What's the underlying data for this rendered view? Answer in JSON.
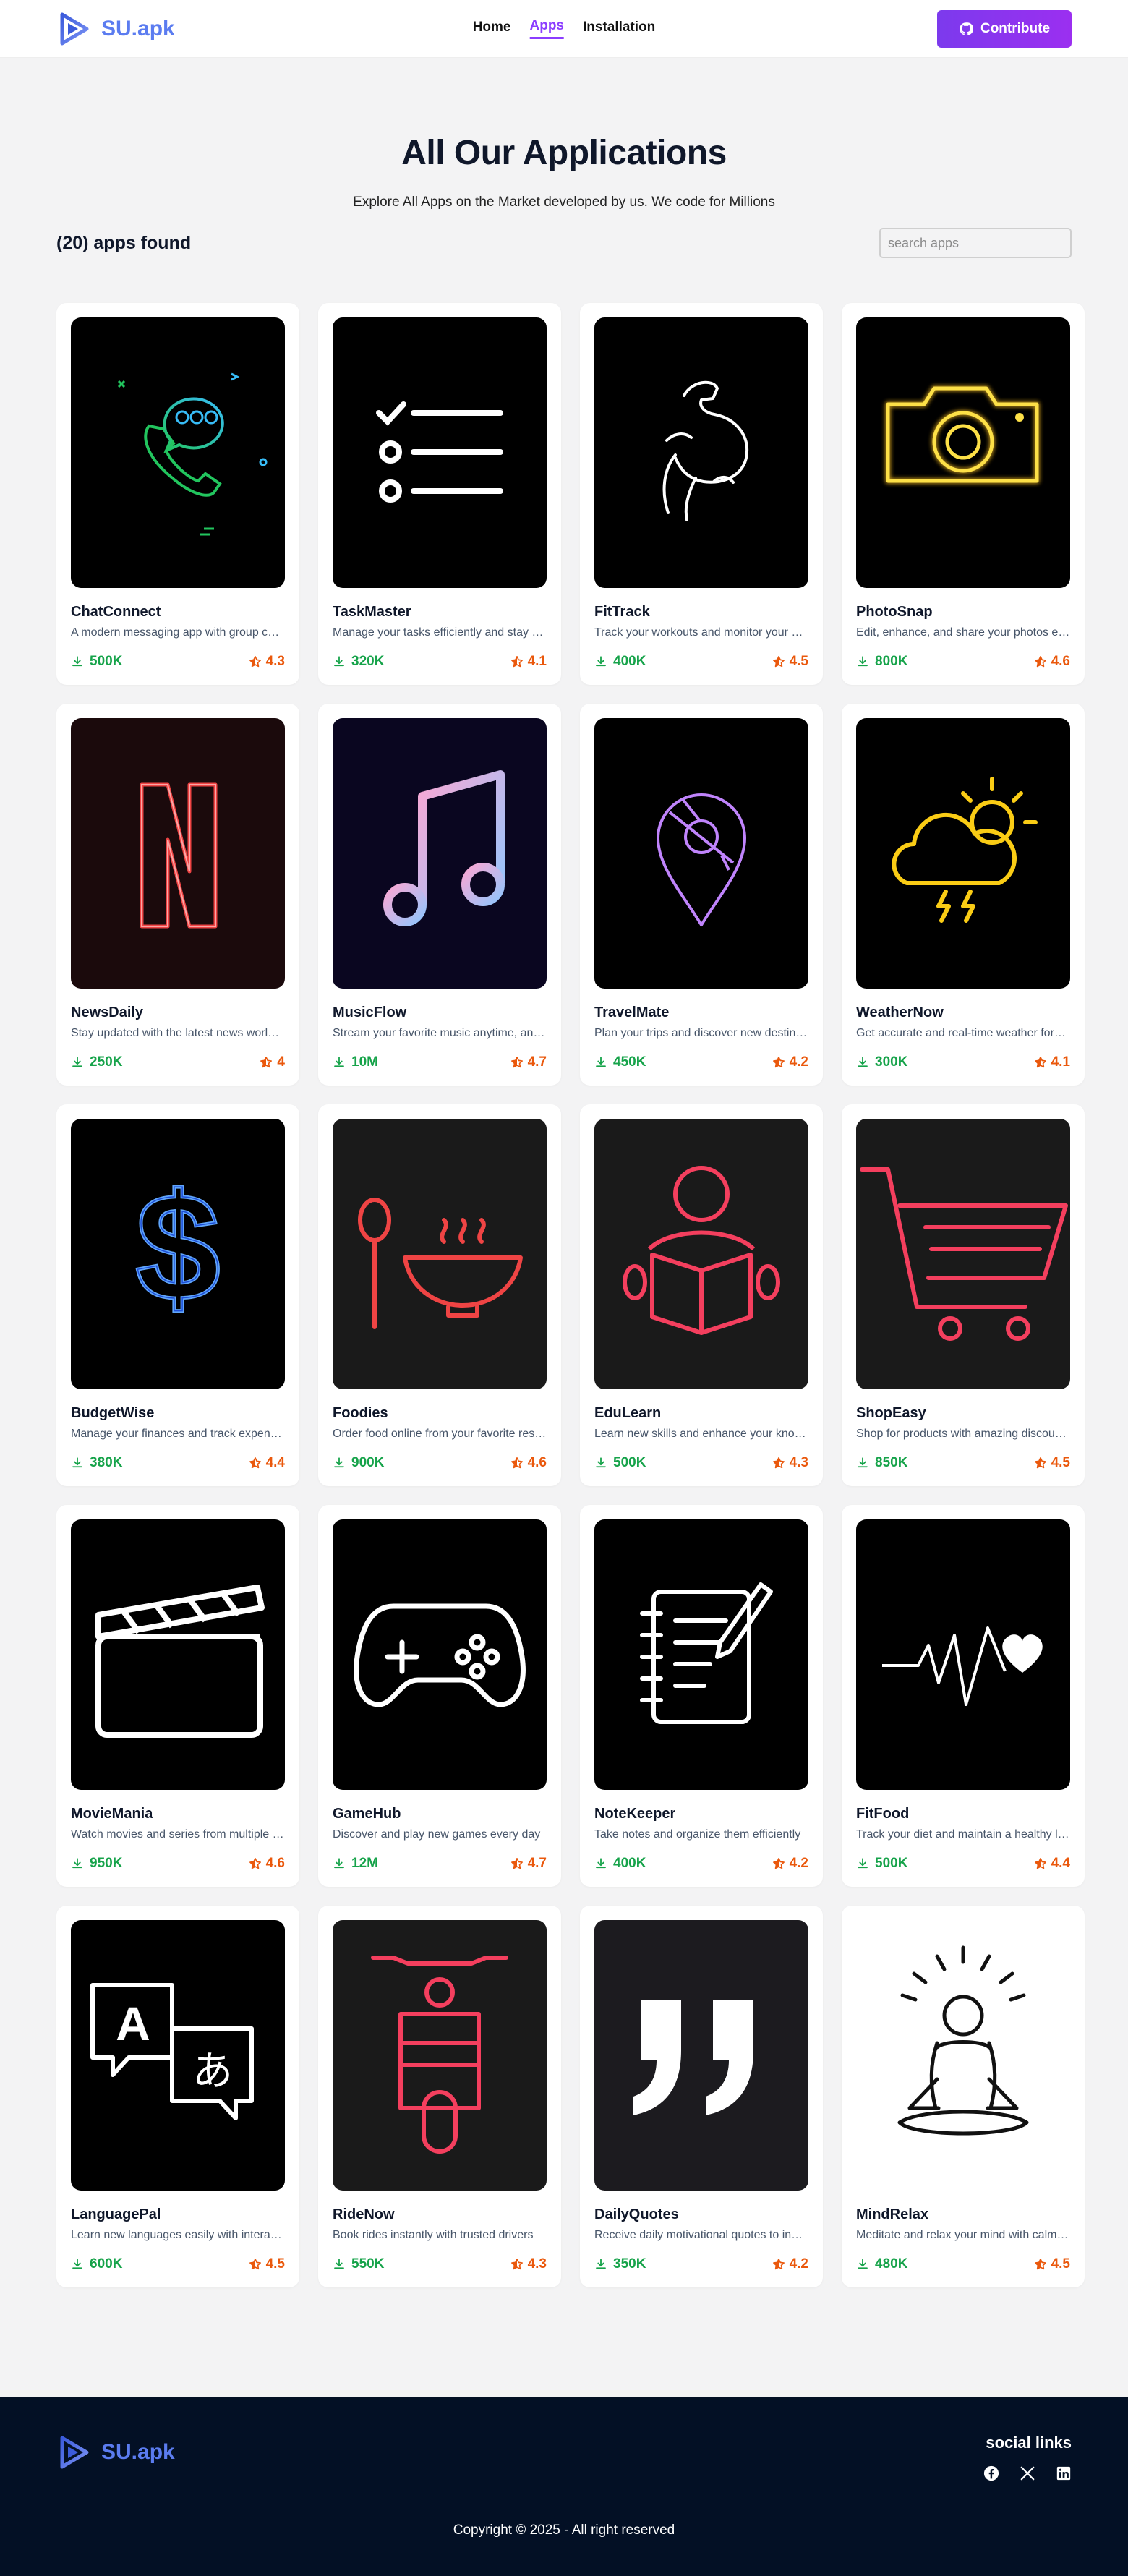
{
  "nav": {
    "brand": "SU.apk",
    "links": [
      "Home",
      "Apps",
      "Installation"
    ],
    "active": "Apps",
    "contribute": "Contribute"
  },
  "hero": {
    "title": "All Our Applications",
    "subtitle": "Explore All Apps on the Market developed by us. We code for Millions"
  },
  "toolbar": {
    "count": "(20) apps found",
    "search_placeholder": "search apps"
  },
  "apps": [
    {
      "name": "ChatConnect",
      "desc": "A modern messaging app with group chats",
      "downloads": "500K",
      "rating": "4.3",
      "icon": "chat-phone-icon"
    },
    {
      "name": "TaskMaster",
      "desc": "Manage your tasks efficiently and stay organized",
      "downloads": "320K",
      "rating": "4.1",
      "icon": "checklist-icon"
    },
    {
      "name": "FitTrack",
      "desc": "Track your workouts and monitor your progress",
      "downloads": "400K",
      "rating": "4.5",
      "icon": "muscle-arm-icon"
    },
    {
      "name": "PhotoSnap",
      "desc": "Edit, enhance, and share your photos easily",
      "downloads": "800K",
      "rating": "4.6",
      "icon": "camera-icon"
    },
    {
      "name": "NewsDaily",
      "desc": "Stay updated with the latest news worldwide",
      "downloads": "250K",
      "rating": "4",
      "icon": "letter-n-icon"
    },
    {
      "name": "MusicFlow",
      "desc": "Stream your favorite music anytime, anywhere",
      "downloads": "10M",
      "rating": "4.7",
      "icon": "music-note-icon"
    },
    {
      "name": "TravelMate",
      "desc": "Plan your trips and discover new destinations",
      "downloads": "450K",
      "rating": "4.2",
      "icon": "map-pin-icon"
    },
    {
      "name": "WeatherNow",
      "desc": "Get accurate and real-time weather forecasts",
      "downloads": "300K",
      "rating": "4.1",
      "icon": "weather-cloud-icon"
    },
    {
      "name": "BudgetWise",
      "desc": "Manage your finances and track expenses",
      "downloads": "380K",
      "rating": "4.4",
      "icon": "dollar-icon"
    },
    {
      "name": "Foodies",
      "desc": "Order food online from your favorite restaurants",
      "downloads": "900K",
      "rating": "4.6",
      "icon": "soup-bowl-icon"
    },
    {
      "name": "EduLearn",
      "desc": "Learn new skills and enhance your knowledge",
      "downloads": "500K",
      "rating": "4.3",
      "icon": "reader-book-icon"
    },
    {
      "name": "ShopEasy",
      "desc": "Shop for products with amazing discounts",
      "downloads": "850K",
      "rating": "4.5",
      "icon": "shopping-cart-icon"
    },
    {
      "name": "MovieMania",
      "desc": "Watch movies and series from multiple genres",
      "downloads": "950K",
      "rating": "4.6",
      "icon": "clapperboard-icon"
    },
    {
      "name": "GameHub",
      "desc": "Discover and play new games every day",
      "downloads": "12M",
      "rating": "4.7",
      "icon": "gamepad-icon"
    },
    {
      "name": "NoteKeeper",
      "desc": "Take notes and organize them efficiently",
      "downloads": "400K",
      "rating": "4.2",
      "icon": "notepad-icon"
    },
    {
      "name": "FitFood",
      "desc": "Track your diet and maintain a healthy lifestyle",
      "downloads": "500K",
      "rating": "4.4",
      "icon": "heartbeat-icon"
    },
    {
      "name": "LanguagePal",
      "desc": "Learn new languages easily with interactive lessons",
      "downloads": "600K",
      "rating": "4.5",
      "icon": "translate-icon"
    },
    {
      "name": "RideNow",
      "desc": "Book rides instantly with trusted drivers",
      "downloads": "550K",
      "rating": "4.3",
      "icon": "scooter-icon"
    },
    {
      "name": "DailyQuotes",
      "desc": "Receive daily motivational quotes to inspire you",
      "downloads": "350K",
      "rating": "4.2",
      "icon": "quote-icon"
    },
    {
      "name": "MindRelax",
      "desc": "Meditate and relax your mind with calming sounds",
      "downloads": "480K",
      "rating": "4.5",
      "icon": "meditation-icon"
    }
  ],
  "footer": {
    "brand": "SU.apk",
    "social_title": "social links",
    "social_icons": [
      "facebook-icon",
      "x-icon",
      "linkedin-icon"
    ],
    "copyright": "Copyright © 2025 - All right reserved"
  },
  "colors": {
    "accent": "#8b3dff",
    "brand": "#5b7cf0",
    "downloads": "#16a34a",
    "rating": "#ea580c",
    "footer_bg": "#031025"
  }
}
